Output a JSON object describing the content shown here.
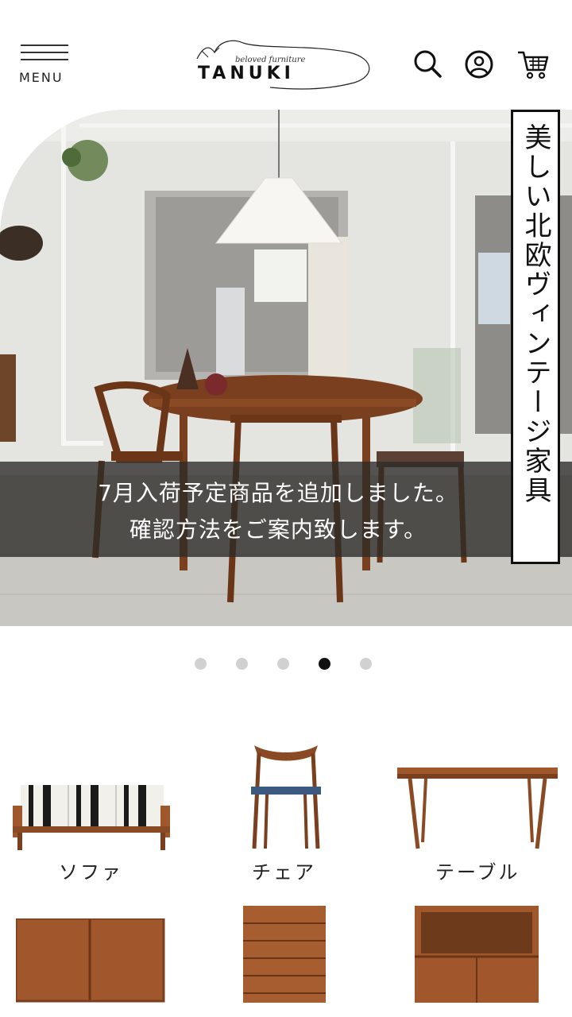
{
  "header": {
    "menu_label": "MENU",
    "logo_tagline": "beloved furniture",
    "logo_name": "TANUKI",
    "icons": [
      "menu-icon",
      "search-icon",
      "account-icon",
      "cart-icon"
    ]
  },
  "hero": {
    "vertical_title": "美しい北欧ヴィンテージ家具",
    "caption": {
      "line1": "7月入荷予定商品を追加しました。",
      "line2": "確認方法をご案内致します。"
    }
  },
  "carousel": {
    "slide_count": 5,
    "active_index": 3
  },
  "categories": [
    {
      "label": "ソファ"
    },
    {
      "label": "チェア"
    },
    {
      "label": "テーブル"
    }
  ],
  "colors": {
    "teak": "#a0572b",
    "dark_teak": "#7a3f1e",
    "caption_bg": "#2d2a28",
    "dot_active": "#111111",
    "dot_inactive": "#d1d1d1"
  }
}
